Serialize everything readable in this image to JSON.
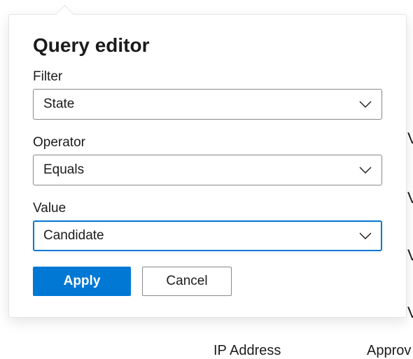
{
  "panel": {
    "title": "Query editor",
    "fields": {
      "filter": {
        "label": "Filter",
        "value": "State"
      },
      "operator": {
        "label": "Operator",
        "value": "Equals"
      },
      "value": {
        "label": "Value",
        "value": "Candidate"
      }
    },
    "buttons": {
      "apply": "Apply",
      "cancel": "Cancel"
    }
  },
  "background": {
    "ip_address": "IP Address",
    "approv": "Approv"
  }
}
